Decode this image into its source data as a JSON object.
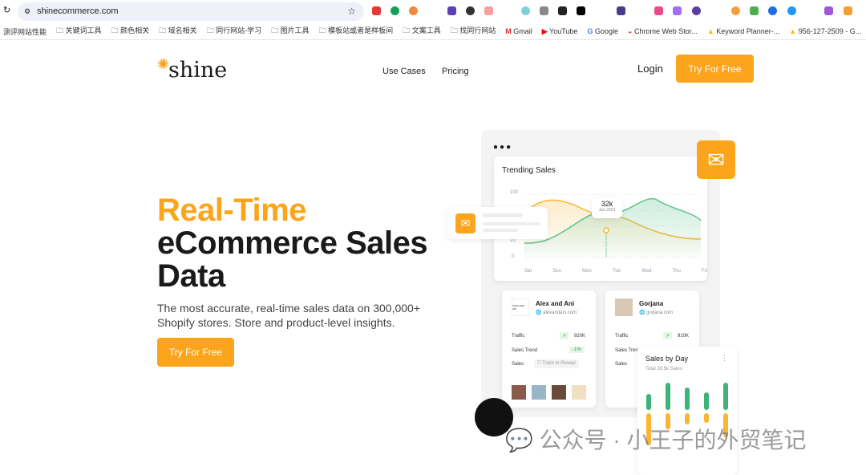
{
  "browser": {
    "url": "shinecommerce.com",
    "bookmarks": [
      "测评网站性能",
      "关键词工具",
      "颜色相关",
      "域名相关",
      "同行网站-学习",
      "图片工具",
      "模板站或者是样板间",
      "文案工具",
      "找同行网站",
      "Gmail",
      "YouTube",
      "Google",
      "Chrome Web Stor...",
      "Keyword Planner-...",
      "956-127-2509 - G..."
    ]
  },
  "header": {
    "logo": "shine",
    "nav": [
      "Use Cases",
      "Pricing"
    ],
    "login": "Login",
    "cta": "Try For Free"
  },
  "hero": {
    "title_accent": "Real-Time",
    "title_line2": "eCommerce Sales",
    "title_line3": "Data",
    "subtitle_line1": "The most accurate, real-time sales data on 300,000+",
    "subtitle_line2": "Shopify stores. Store and product-level insights.",
    "cta": "Try For Free"
  },
  "mockup": {
    "trending": {
      "title": "Trending Sales",
      "y_ticks": [
        "100",
        "20",
        "0"
      ],
      "days": [
        "Sat",
        "Sun",
        "Mon",
        "Tue",
        "Wed",
        "Thu",
        "Fri"
      ],
      "tooltip_value": "32k",
      "tooltip_date": "Jan,2023",
      "colors": {
        "orange": "#fbb531",
        "green": "#5cc28e"
      }
    },
    "stores": [
      {
        "name": "Alex and Ani",
        "domain": "alexandani.com",
        "logo_text": "ALEX AND ANI",
        "traffic": "920K",
        "sales_trend": "-1%",
        "sales": "Track to Reveal"
      },
      {
        "name": "Gorjana",
        "domain": "gorjana.com",
        "traffic": "910K"
      }
    ],
    "labels": {
      "traffic": "Traffic",
      "sales_trend": "Sales Trend",
      "sales": "Sales"
    },
    "sales_by_day": {
      "title": "Sales by Day",
      "subtitle": "Total 28.5k Sales"
    }
  },
  "watermark": "公众号 · 小王子的外贸笔记"
}
